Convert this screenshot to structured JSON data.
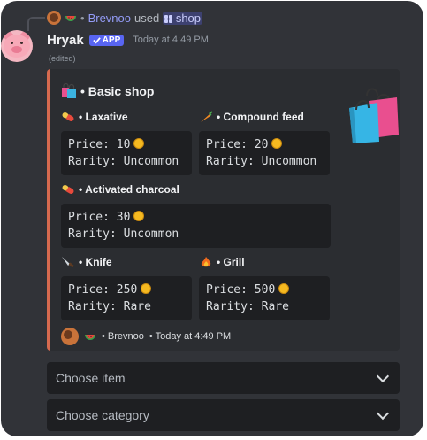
{
  "reply": {
    "user": "Brevnoo",
    "verb": "used",
    "command": "shop"
  },
  "message": {
    "author": "Hryak",
    "app_tag": "APP",
    "timestamp": "Today at 4:49 PM",
    "edited": "(edited)"
  },
  "embed": {
    "accent_color": "#d66a4f",
    "title": "• Basic shop",
    "fields": [
      {
        "name": "• Laxative",
        "icon": "pill-icon",
        "price": "Price: 10",
        "rarity": "Rarity: Uncommon"
      },
      {
        "name": "• Compound feed",
        "icon": "carrot-icon",
        "price": "Price: 20",
        "rarity": "Rarity: Uncommon"
      },
      {
        "name": "• Activated charcoal",
        "icon": "pill-icon",
        "price": "Price: 30",
        "rarity": "Rarity: Uncommon"
      },
      {
        "name": "• Knife",
        "icon": "knife-icon",
        "price": "Price: 250",
        "rarity": "Rarity: Rare"
      },
      {
        "name": "• Grill",
        "icon": "fire-icon",
        "price": "Price: 500",
        "rarity": "Rarity: Rare"
      }
    ],
    "footer": {
      "user": "• Brevnoo",
      "timestamp": "• Today at 4:49 PM"
    }
  },
  "selects": {
    "item_placeholder": "Choose item",
    "category_placeholder": "Choose category"
  }
}
